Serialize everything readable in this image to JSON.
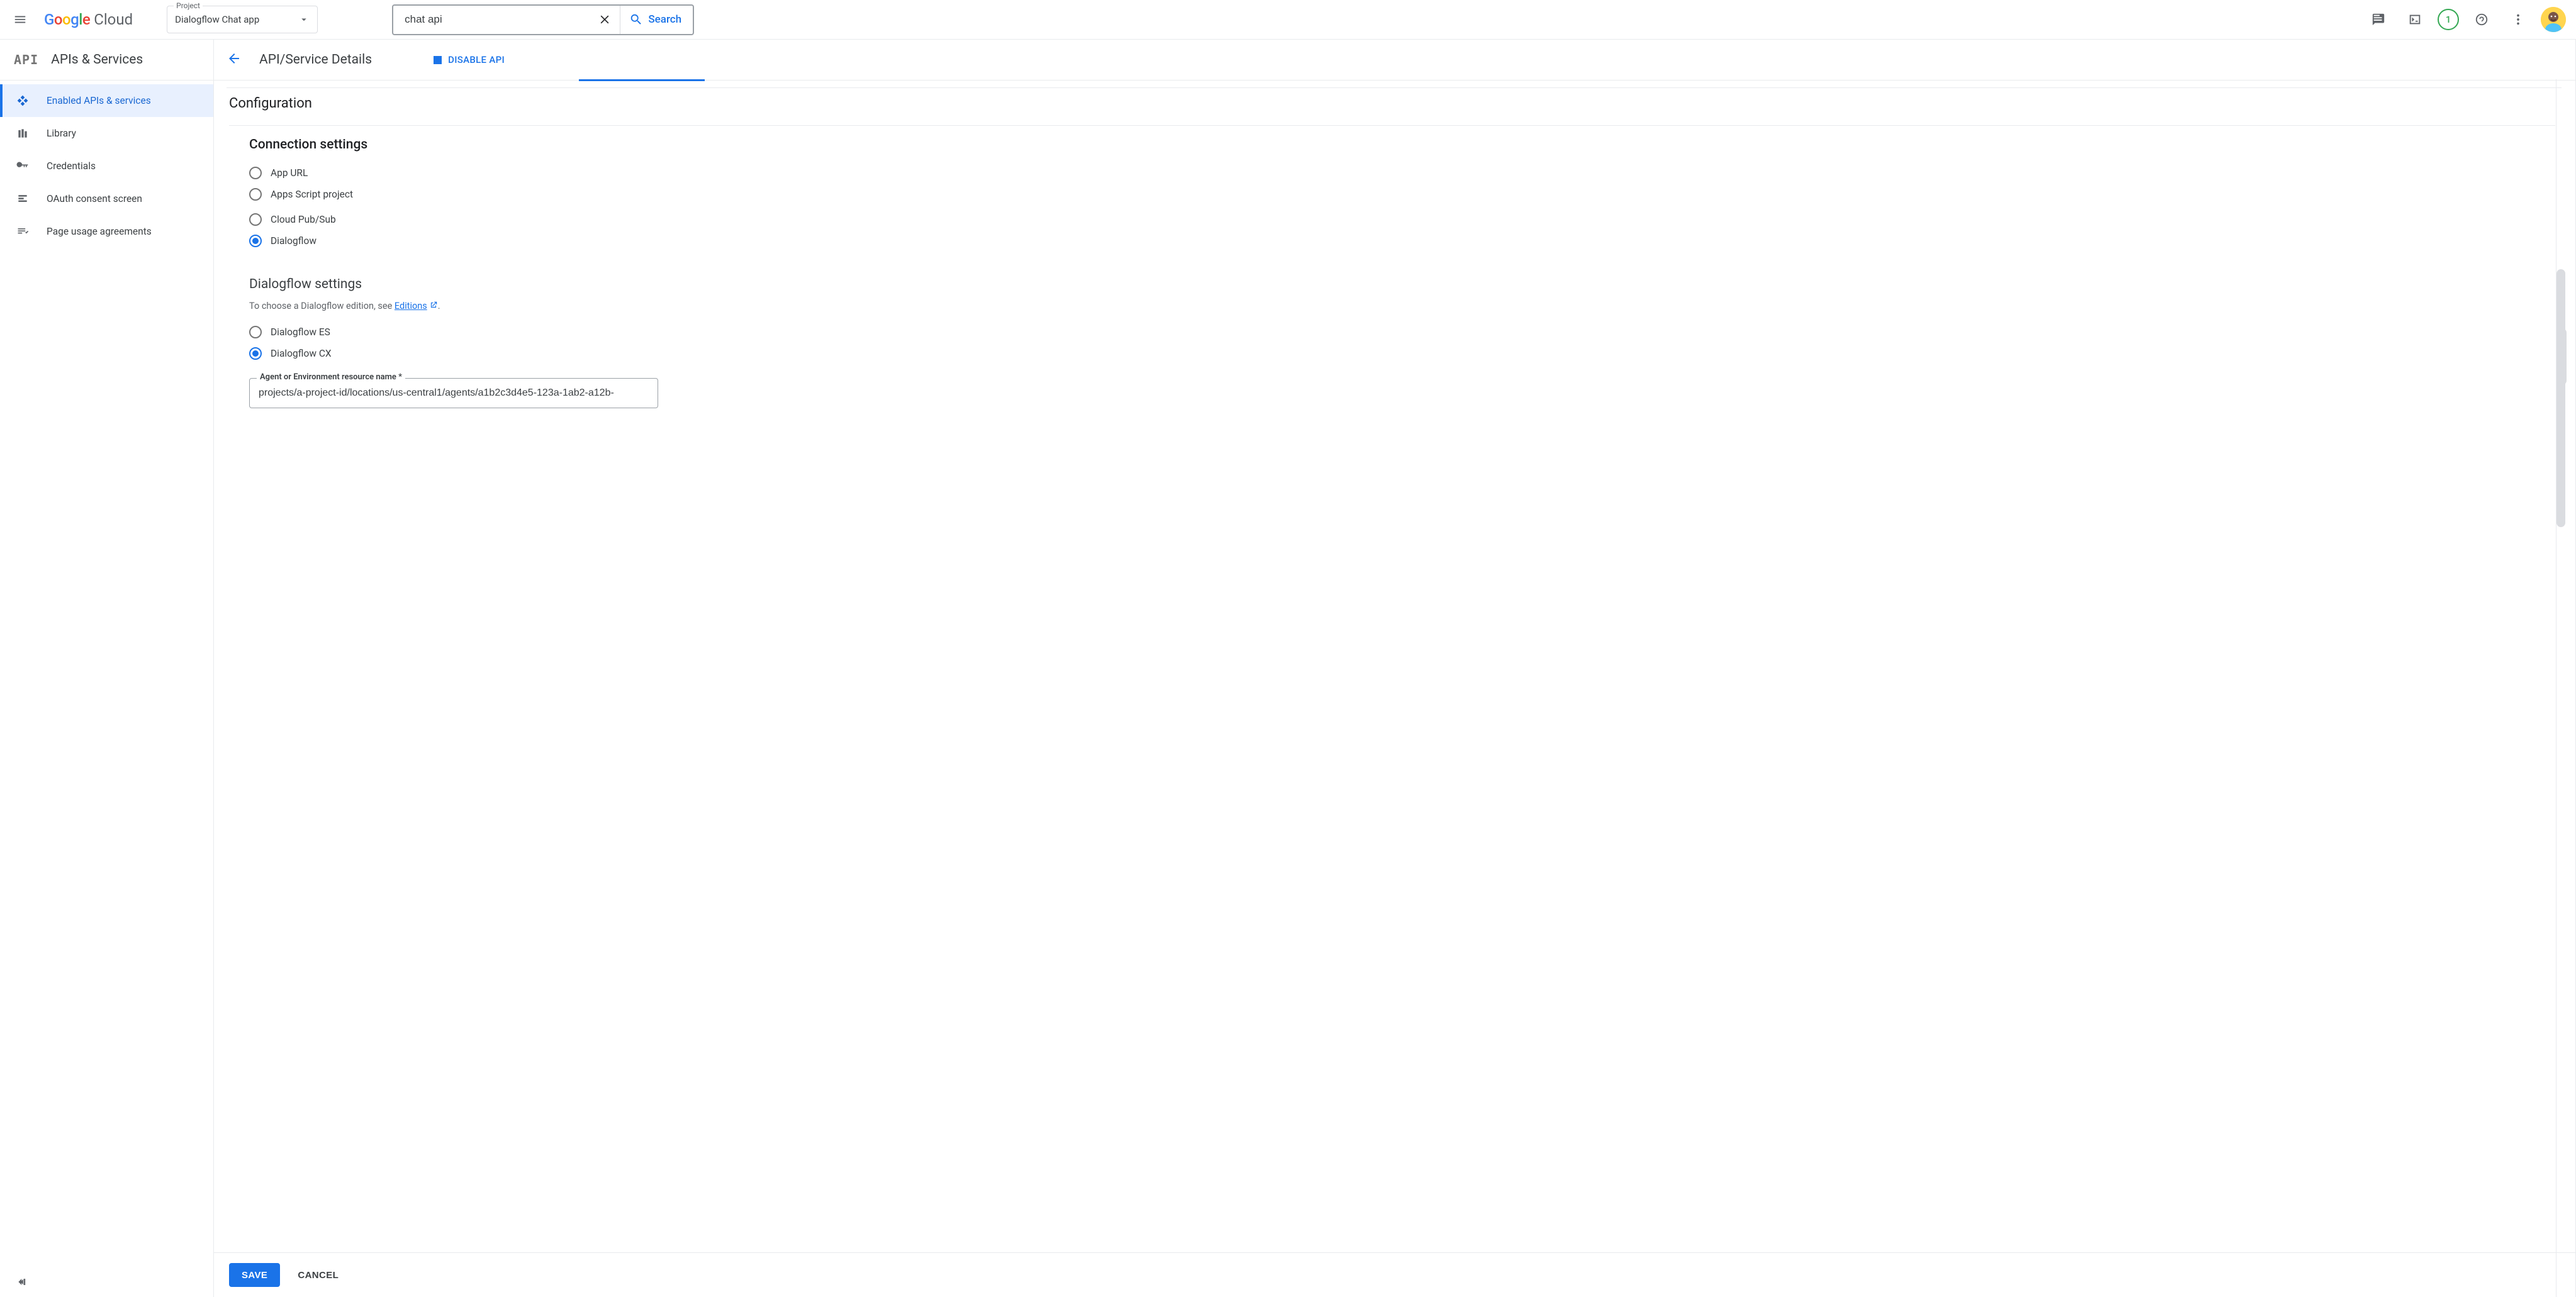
{
  "header": {
    "logo_cloud": "Cloud",
    "project_label": "Project",
    "project_name": "Dialogflow Chat app",
    "search_value": "chat api",
    "search_button": "Search",
    "badge_count": "1"
  },
  "sidebar": {
    "section": "APIs & Services",
    "items": [
      {
        "label": "Enabled APIs & services",
        "active": true
      },
      {
        "label": "Library"
      },
      {
        "label": "Credentials"
      },
      {
        "label": "OAuth consent screen"
      },
      {
        "label": "Page usage agreements"
      }
    ]
  },
  "page": {
    "title": "API/Service Details",
    "disable_api": "DISABLE API",
    "config_heading": "Configuration",
    "connection_heading": "Connection settings",
    "connection_options": [
      {
        "label": "App URL",
        "checked": false
      },
      {
        "label": "Apps Script project",
        "checked": false
      },
      {
        "label": "Cloud Pub/Sub",
        "checked": false
      },
      {
        "label": "Dialogflow",
        "checked": true
      }
    ],
    "dialogflow_heading": "Dialogflow settings",
    "dialogflow_helper_prefix": "To choose a Dialogflow edition, see ",
    "dialogflow_helper_link": "Editions",
    "dialogflow_helper_suffix": ".",
    "dialogflow_edition_options": [
      {
        "label": "Dialogflow ES",
        "checked": false
      },
      {
        "label": "Dialogflow CX",
        "checked": true
      }
    ],
    "agent_field_label": "Agent or Environment resource name *",
    "agent_field_value": "projects/a-project-id/locations/us-central1/agents/a1b2c3d4e5-123a-1ab2-a12b-",
    "save": "SAVE",
    "cancel": "CANCEL"
  }
}
